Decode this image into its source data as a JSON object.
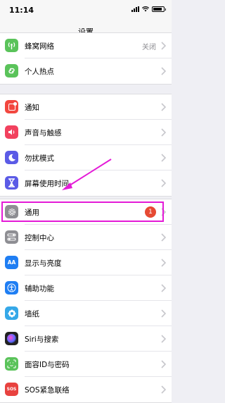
{
  "status_bar": {
    "time": "11:14"
  },
  "nav": {
    "title": "设置"
  },
  "group1": [
    {
      "label": "蜂窝网络",
      "detail": "关闭",
      "icon": "cellular-icon",
      "color": "#5ac35a"
    },
    {
      "label": "个人热点",
      "icon": "hotspot-icon",
      "color": "#5ac35a"
    }
  ],
  "group2": [
    {
      "label": "通知",
      "icon": "notifications-icon",
      "color": "#f2473f"
    },
    {
      "label": "声音与触感",
      "icon": "sounds-icon",
      "color": "#f2415e"
    },
    {
      "label": "勿扰模式",
      "icon": "moon-icon",
      "color": "#5b5be6"
    },
    {
      "label": "屏幕使用时间",
      "icon": "hourglass-icon",
      "color": "#5b5be6"
    }
  ],
  "group3": [
    {
      "label": "通用",
      "badge": "1",
      "icon": "gear-icon",
      "color": "#8e8e93"
    },
    {
      "label": "控制中心",
      "icon": "control-center-icon",
      "color": "#8e8e93"
    },
    {
      "label": "显示与亮度",
      "icon_text": "AA",
      "icon": "display-icon",
      "color": "#1f7ef3"
    },
    {
      "label": "辅助功能",
      "icon": "accessibility-icon",
      "color": "#1f7ef3"
    },
    {
      "label": "墙纸",
      "icon": "wallpaper-icon",
      "color": "#35a8e8"
    },
    {
      "label": "Siri与搜索",
      "icon": "siri-icon",
      "color": "#222222"
    },
    {
      "label": "面容ID与密码",
      "icon": "face-id-icon",
      "color": "#5ac35a"
    },
    {
      "label": "SOS紧急联络",
      "icon_text": "SOS",
      "icon": "sos-icon",
      "color": "#e8423f"
    }
  ],
  "annotation": {
    "highlight_color": "#e41ad7"
  }
}
